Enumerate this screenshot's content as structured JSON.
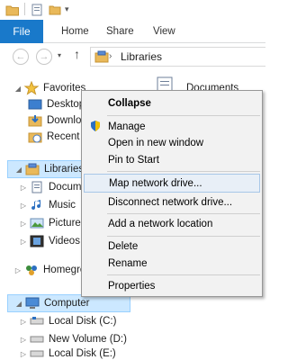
{
  "ribbon": {
    "file_label": "File",
    "tabs": [
      "Home",
      "Share",
      "View"
    ]
  },
  "address": {
    "path": "Libraries"
  },
  "navpane": {
    "favorites": {
      "label": "Favorites",
      "items": [
        "Desktop",
        "Downlo",
        "Recent p"
      ]
    },
    "libraries": {
      "label": "Libraries",
      "items": [
        "Docume",
        "Music",
        "Pictures",
        "Videos"
      ]
    },
    "homegroup": {
      "label": "Homegro"
    },
    "computer": {
      "label": "Computer",
      "items": [
        "Local Disk (C:)",
        "New Volume (D:)",
        "Local Disk (E:)"
      ]
    }
  },
  "content": {
    "item_label": "Documents"
  },
  "context_menu": {
    "items": [
      "Collapse",
      "Manage",
      "Open in new window",
      "Pin to Start",
      "Map network drive...",
      "Disconnect network drive...",
      "Add a network location",
      "Delete",
      "Rename",
      "Properties"
    ],
    "highlighted": "Map network drive..."
  },
  "colors": {
    "file_tab": "#1979ca",
    "selection": "#cce8ff",
    "menu_bg": "#f2f2f2"
  }
}
